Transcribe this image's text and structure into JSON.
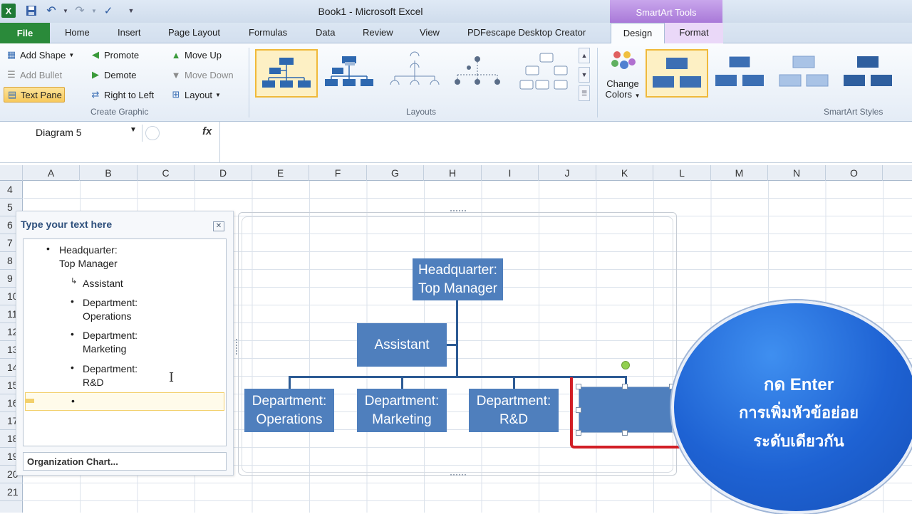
{
  "window": {
    "title": "Book1  -  Microsoft Excel",
    "contextual_tab": "SmartArt Tools"
  },
  "tabs": {
    "file": "File",
    "home": "Home",
    "insert": "Insert",
    "page_layout": "Page Layout",
    "formulas": "Formulas",
    "data": "Data",
    "review": "Review",
    "view": "View",
    "pdfescape": "PDFescape Desktop Creator",
    "design": "Design",
    "format": "Format"
  },
  "ribbon": {
    "create_graphic": {
      "add_shape": "Add Shape",
      "add_bullet": "Add Bullet",
      "text_pane": "Text Pane",
      "promote": "Promote",
      "demote": "Demote",
      "right_to_left": "Right to Left",
      "move_up": "Move Up",
      "move_down": "Move Down",
      "layout": "Layout",
      "label": "Create Graphic"
    },
    "layouts": {
      "label": "Layouts"
    },
    "smartart_styles": {
      "change_colors_line1": "Change",
      "change_colors_line2": "Colors",
      "label": "SmartArt Styles"
    }
  },
  "formula_bar": {
    "name_box": "Diagram 5",
    "fx": "fx"
  },
  "sheet": {
    "columns": [
      "A",
      "B",
      "C",
      "D",
      "E",
      "F",
      "G",
      "H",
      "I",
      "J",
      "K",
      "L",
      "M",
      "N",
      "O"
    ],
    "rows": [
      "4",
      "5",
      "6",
      "7",
      "8",
      "9",
      "10",
      "11",
      "12",
      "13",
      "14",
      "15",
      "16",
      "17",
      "18",
      "19",
      "20",
      "21"
    ]
  },
  "text_pane": {
    "title": "Type your text here",
    "items": [
      {
        "line1": "Headquarter:",
        "line2": "Top Manager"
      },
      {
        "line1": "Assistant"
      },
      {
        "line1": "Department:",
        "line2": "Operations"
      },
      {
        "line1": "Department:",
        "line2": "Marketing"
      },
      {
        "line1": "Department:",
        "line2": "R&D"
      }
    ],
    "footer": "Organization Chart..."
  },
  "org_chart": {
    "top": {
      "line1": "Headquarter:",
      "line2": "Top Manager"
    },
    "assistant": "Assistant",
    "departments": [
      {
        "line1": "Department:",
        "line2": "Operations"
      },
      {
        "line1": "Department:",
        "line2": "Marketing"
      },
      {
        "line1": "Department:",
        "line2": "R&D"
      }
    ]
  },
  "callout": {
    "line1": "กด Enter",
    "line2": "การเพิ่มหัวข้อย่อย",
    "line3": "ระดับเดียวกัน"
  },
  "colors": {
    "file_tab": "#2a8a3a",
    "shape_fill": "#4f7fbd",
    "callout": "#1e62d3",
    "highlight": "#d21f26"
  }
}
